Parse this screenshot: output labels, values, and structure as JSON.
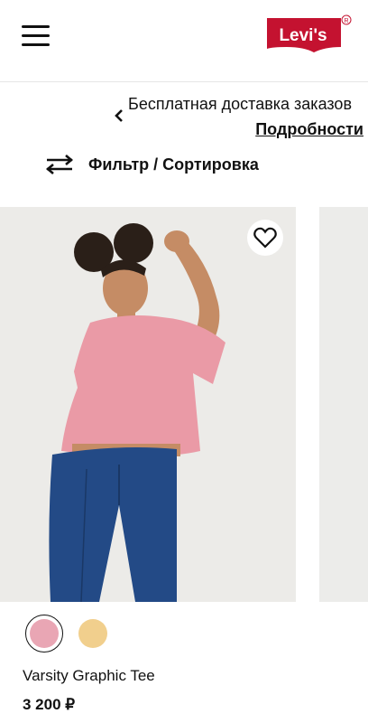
{
  "header": {
    "menu_icon": "hamburger-menu-icon",
    "logo_text": "Levi's",
    "brand_color": "#c41230"
  },
  "promo": {
    "text": "Бесплатная доставка заказов",
    "link": "Подробности",
    "prev_icon": "chevron-left-icon"
  },
  "filter": {
    "label": "Фильтр / Сортировка",
    "icon": "sliders-icon"
  },
  "product": {
    "name": "Varsity Graphic Tee",
    "price": "3 200 ₽",
    "wishlist_icon": "heart-icon",
    "swatches": [
      {
        "color": "#e9a6b4",
        "selected": true
      },
      {
        "color": "#f1cf8d",
        "selected": false
      }
    ]
  }
}
